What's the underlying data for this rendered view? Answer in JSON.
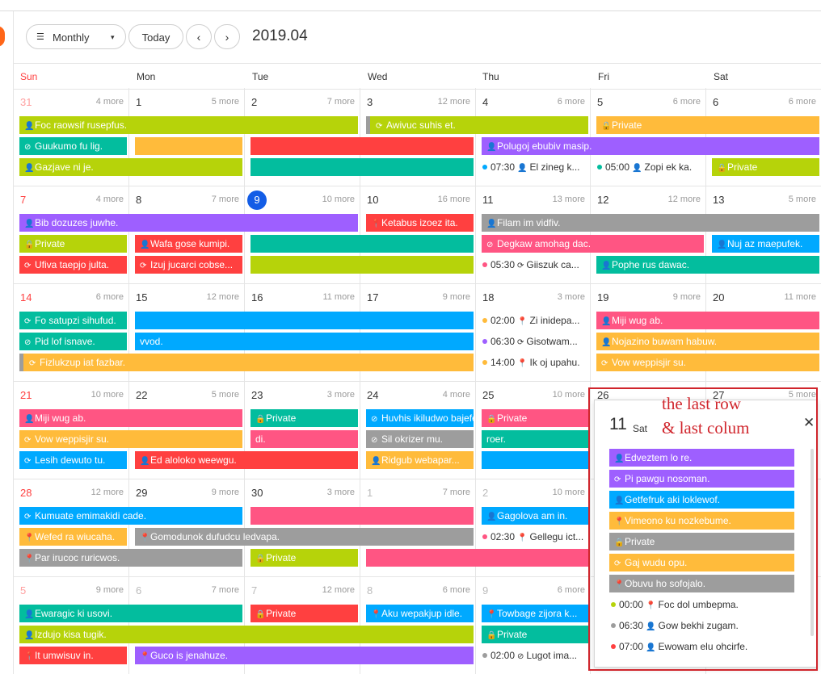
{
  "toolbar": {
    "view_label": "Monthly",
    "view_icon": "☰",
    "caret": "▾",
    "today_label": "Today",
    "prev_label": "‹",
    "next_label": "›",
    "date_range": "2019.04"
  },
  "weekdays": [
    "Sun",
    "Mon",
    "Tue",
    "Wed",
    "Thu",
    "Fri",
    "Sat"
  ],
  "weeks": [
    [
      {
        "d": "31",
        "m": "4 more",
        "s": "prevred"
      },
      {
        "d": "1",
        "m": "5 more"
      },
      {
        "d": "2",
        "m": "7 more"
      },
      {
        "d": "3",
        "m": "12 more"
      },
      {
        "d": "4",
        "m": "6 more"
      },
      {
        "d": "5",
        "m": "6 more"
      },
      {
        "d": "6",
        "m": "6 more"
      }
    ],
    [
      {
        "d": "7",
        "m": "4 more",
        "s": "red"
      },
      {
        "d": "8",
        "m": "7 more"
      },
      {
        "d": "9",
        "m": "10 more",
        "s": "today"
      },
      {
        "d": "10",
        "m": "16 more"
      },
      {
        "d": "11",
        "m": "13 more"
      },
      {
        "d": "12",
        "m": "12 more"
      },
      {
        "d": "13",
        "m": "5 more"
      }
    ],
    [
      {
        "d": "14",
        "m": "6 more",
        "s": "red"
      },
      {
        "d": "15",
        "m": "12 more"
      },
      {
        "d": "16",
        "m": "11 more"
      },
      {
        "d": "17",
        "m": "9 more"
      },
      {
        "d": "18",
        "m": "3 more"
      },
      {
        "d": "19",
        "m": "9 more"
      },
      {
        "d": "20",
        "m": "11 more"
      }
    ],
    [
      {
        "d": "21",
        "m": "10 more",
        "s": "red"
      },
      {
        "d": "22",
        "m": "5 more"
      },
      {
        "d": "23",
        "m": "3 more"
      },
      {
        "d": "24",
        "m": "4 more"
      },
      {
        "d": "25",
        "m": "10 more"
      },
      {
        "d": "26",
        "m": ""
      },
      {
        "d": "27",
        "m": "5 more"
      }
    ],
    [
      {
        "d": "28",
        "m": "12 more",
        "s": "red"
      },
      {
        "d": "29",
        "m": "9 more"
      },
      {
        "d": "30",
        "m": "3 more"
      },
      {
        "d": "1",
        "m": "7 more",
        "s": "prev"
      },
      {
        "d": "2",
        "m": "10 more",
        "s": "prev"
      },
      {
        "d": "",
        "m": ""
      },
      {
        "d": "",
        "m": ""
      }
    ],
    [
      {
        "d": "5",
        "m": "9 more",
        "s": "prevred"
      },
      {
        "d": "6",
        "m": "7 more",
        "s": "prev"
      },
      {
        "d": "7",
        "m": "12 more",
        "s": "prev"
      },
      {
        "d": "8",
        "m": "6 more",
        "s": "prev"
      },
      {
        "d": "9",
        "m": "6 more",
        "s": "prev"
      },
      {
        "d": "",
        "m": ""
      },
      {
        "d": "",
        "m": ""
      }
    ]
  ],
  "colors": {
    "lime": "#b6d30a",
    "green": "#03bd9e",
    "blue": "#00a9ff",
    "purple": "#9e5fff",
    "orange": "#ffbb3b",
    "red": "#ff4040",
    "pink": "#ff5583",
    "gray": "#9d9d9d"
  },
  "events": [
    {
      "w": 0,
      "c": 0,
      "span": 3,
      "r": 0,
      "title": "Foc raowsif rusepfus.",
      "icon": "👤",
      "color": "lime"
    },
    {
      "w": 0,
      "c": 3,
      "span": 2,
      "r": 0,
      "title": "Awivuc suhis et.",
      "icon": "⟳",
      "color": "lime",
      "lead": "gray"
    },
    {
      "w": 0,
      "c": 5,
      "span": 2,
      "r": 0,
      "title": "Private",
      "icon": "🔒",
      "color": "orange"
    },
    {
      "w": 0,
      "c": 0,
      "span": 1,
      "r": 1,
      "title": "Guukumo fu lig.",
      "icon": "⊘",
      "color": "green"
    },
    {
      "w": 0,
      "c": 1,
      "span": 1,
      "r": 1,
      "title": "",
      "icon": "",
      "color": "orange"
    },
    {
      "w": 0,
      "c": 2,
      "span": 2,
      "r": 1,
      "title": "",
      "icon": "",
      "color": "red"
    },
    {
      "w": 0,
      "c": 4,
      "span": 3,
      "r": 1,
      "title": "Polugoj ebubiv masip.",
      "icon": "👤",
      "color": "purple"
    },
    {
      "w": 0,
      "c": 0,
      "span": 2,
      "r": 2,
      "title": "Gazjave ni je.",
      "icon": "👤",
      "color": "lime"
    },
    {
      "w": 0,
      "c": 2,
      "span": 2,
      "r": 2,
      "title": "",
      "icon": "",
      "color": "green"
    },
    {
      "w": 0,
      "c": 6,
      "span": 1,
      "r": 2,
      "title": "Private",
      "icon": "🔒",
      "color": "lime"
    },
    {
      "w": 1,
      "c": 0,
      "span": 3,
      "r": 0,
      "title": "Bib dozuzes juwhe.",
      "icon": "👤",
      "color": "purple"
    },
    {
      "w": 1,
      "c": 3,
      "span": 1,
      "r": 0,
      "title": "Ketabus izoez ita.",
      "icon": "📍",
      "color": "red"
    },
    {
      "w": 1,
      "c": 4,
      "span": 3,
      "r": 0,
      "title": "Filam im vidfiv.",
      "icon": "👤",
      "color": "gray"
    },
    {
      "w": 1,
      "c": 0,
      "span": 1,
      "r": 1,
      "title": "Private",
      "icon": "🔒",
      "color": "lime"
    },
    {
      "w": 1,
      "c": 1,
      "span": 1,
      "r": 1,
      "title": "Wafa gose kumipi.",
      "icon": "👤",
      "color": "red"
    },
    {
      "w": 1,
      "c": 2,
      "span": 2,
      "r": 1,
      "title": "",
      "icon": "",
      "color": "green"
    },
    {
      "w": 1,
      "c": 4,
      "span": 2,
      "r": 1,
      "title": "Degkaw amohag dac.",
      "icon": "⊘",
      "color": "pink"
    },
    {
      "w": 1,
      "c": 6,
      "span": 1,
      "r": 1,
      "title": "Nuj az maepufek.",
      "icon": "👤",
      "color": "blue"
    },
    {
      "w": 1,
      "c": 0,
      "span": 1,
      "r": 2,
      "title": "Ufiva taepjo julta.",
      "icon": "⟳",
      "color": "red"
    },
    {
      "w": 1,
      "c": 1,
      "span": 1,
      "r": 2,
      "title": "Izuj jucarci cobse...",
      "icon": "⟳",
      "color": "red"
    },
    {
      "w": 1,
      "c": 2,
      "span": 2,
      "r": 2,
      "title": "",
      "icon": "",
      "color": "lime"
    },
    {
      "w": 1,
      "c": 5,
      "span": 2,
      "r": 2,
      "title": "Pophe rus dawac.",
      "icon": "👤",
      "color": "green"
    },
    {
      "w": 2,
      "c": 0,
      "span": 1,
      "r": 0,
      "title": "Fo satupzi sihufud.",
      "icon": "⟳",
      "color": "green"
    },
    {
      "w": 2,
      "c": 1,
      "span": 3,
      "r": 0,
      "title": "",
      "icon": "",
      "color": "blue"
    },
    {
      "w": 2,
      "c": 5,
      "span": 2,
      "r": 0,
      "title": "Miji wug ab.",
      "icon": "👤",
      "color": "pink"
    },
    {
      "w": 2,
      "c": 0,
      "span": 1,
      "r": 1,
      "title": "Pid lof isnave.",
      "icon": "⊘",
      "color": "green"
    },
    {
      "w": 2,
      "c": 1,
      "span": 3,
      "r": 1,
      "title": "vvod.",
      "icon": "",
      "color": "blue"
    },
    {
      "w": 2,
      "c": 5,
      "span": 2,
      "r": 1,
      "title": "Nojazino buwam habuw.",
      "icon": "👤",
      "color": "orange"
    },
    {
      "w": 2,
      "c": 0,
      "span": 4,
      "r": 2,
      "title": "Fizlukzup iat fazbar.",
      "icon": "⟳",
      "color": "orange",
      "lead": "gray"
    },
    {
      "w": 2,
      "c": 5,
      "span": 2,
      "r": 2,
      "title": "Vow weppisjir su.",
      "icon": "⟳",
      "color": "orange"
    },
    {
      "w": 3,
      "c": 0,
      "span": 2,
      "r": 0,
      "title": "Miji wug ab.",
      "icon": "👤",
      "color": "pink"
    },
    {
      "w": 3,
      "c": 2,
      "span": 1,
      "r": 0,
      "title": "Private",
      "icon": "🔒",
      "color": "green"
    },
    {
      "w": 3,
      "c": 3,
      "span": 1,
      "r": 0,
      "title": "Huvhis ikiludwo bajefe",
      "icon": "⊘",
      "color": "blue"
    },
    {
      "w": 3,
      "c": 4,
      "span": 1,
      "r": 0,
      "title": "Private",
      "icon": "🔒",
      "color": "pink"
    },
    {
      "w": 3,
      "c": 0,
      "span": 2,
      "r": 1,
      "title": "Vow weppisjir su.",
      "icon": "⟳",
      "color": "orange"
    },
    {
      "w": 3,
      "c": 2,
      "span": 1,
      "r": 1,
      "title": "di.",
      "icon": "",
      "color": "pink"
    },
    {
      "w": 3,
      "c": 3,
      "span": 1,
      "r": 1,
      "title": "Sil okrizer mu.",
      "icon": "⊘",
      "color": "gray"
    },
    {
      "w": 3,
      "c": 4,
      "span": 1,
      "r": 1,
      "title": "roer.",
      "icon": "",
      "color": "green"
    },
    {
      "w": 3,
      "c": 0,
      "span": 1,
      "r": 2,
      "title": "Lesih dewuto tu.",
      "icon": "⟳",
      "color": "blue"
    },
    {
      "w": 3,
      "c": 1,
      "span": 2,
      "r": 2,
      "title": "Ed aloloko weewgu.",
      "icon": "👤",
      "color": "red"
    },
    {
      "w": 3,
      "c": 3,
      "span": 1,
      "r": 2,
      "title": "Ridgub webapar...",
      "icon": "👤",
      "color": "orange"
    },
    {
      "w": 3,
      "c": 4,
      "span": 1,
      "r": 2,
      "title": "",
      "icon": "",
      "color": "blue"
    },
    {
      "w": 4,
      "c": 0,
      "span": 2,
      "r": 0,
      "title": "Kumuate emimakidi cade.",
      "icon": "⟳",
      "color": "blue"
    },
    {
      "w": 4,
      "c": 2,
      "span": 2,
      "r": 0,
      "title": "",
      "icon": "",
      "color": "pink"
    },
    {
      "w": 4,
      "c": 4,
      "span": 1,
      "r": 0,
      "title": "Gagolova am in.",
      "icon": "👤",
      "color": "blue"
    },
    {
      "w": 4,
      "c": 0,
      "span": 1,
      "r": 1,
      "title": "Wefed ra wiucaha.",
      "icon": "📍",
      "color": "orange"
    },
    {
      "w": 4,
      "c": 1,
      "span": 3,
      "r": 1,
      "title": "Gomodunok dufudcu ledvapa.",
      "icon": "📍",
      "color": "gray"
    },
    {
      "w": 4,
      "c": 0,
      "span": 2,
      "r": 2,
      "title": "Par irucoc ruricwos.",
      "icon": "📍",
      "color": "gray"
    },
    {
      "w": 4,
      "c": 2,
      "span": 1,
      "r": 2,
      "title": "Private",
      "icon": "🔒",
      "color": "lime"
    },
    {
      "w": 4,
      "c": 3,
      "span": 2,
      "r": 2,
      "title": "",
      "icon": "",
      "color": "pink"
    },
    {
      "w": 5,
      "c": 0,
      "span": 2,
      "r": 0,
      "title": "Ewaragic ki usovi.",
      "icon": "👤",
      "color": "green"
    },
    {
      "w": 5,
      "c": 2,
      "span": 1,
      "r": 0,
      "title": "Private",
      "icon": "🔒",
      "color": "red"
    },
    {
      "w": 5,
      "c": 3,
      "span": 1,
      "r": 0,
      "title": "Aku wepakjup idle.",
      "icon": "📍",
      "color": "blue"
    },
    {
      "w": 5,
      "c": 4,
      "span": 1,
      "r": 0,
      "title": "Towbage zijora k...",
      "icon": "📍",
      "color": "blue"
    },
    {
      "w": 5,
      "c": 0,
      "span": 4,
      "r": 1,
      "title": "Izdujo kisa tugik.",
      "icon": "👤",
      "color": "lime"
    },
    {
      "w": 5,
      "c": 4,
      "span": 1,
      "r": 1,
      "title": "Private",
      "icon": "🔒",
      "color": "green"
    },
    {
      "w": 5,
      "c": 0,
      "span": 1,
      "r": 2,
      "title": "It umwisuv in.",
      "icon": "📍",
      "color": "red"
    },
    {
      "w": 5,
      "c": 1,
      "span": 3,
      "r": 2,
      "title": "Guco is jenahuze.",
      "icon": "📍",
      "color": "purple"
    }
  ],
  "timed": [
    {
      "w": 0,
      "c": 4,
      "r": 2,
      "time": "07:30",
      "icon": "👤",
      "title": "El zineg k...",
      "dot": "blue"
    },
    {
      "w": 0,
      "c": 5,
      "r": 2,
      "time": "05:00",
      "icon": "👤",
      "title": "Zopi ek ka.",
      "dot": "green"
    },
    {
      "w": 1,
      "c": 4,
      "r": 2,
      "time": "05:30",
      "icon": "⟳",
      "title": "Giiszuk ca...",
      "dot": "pink"
    },
    {
      "w": 2,
      "c": 4,
      "r": 0,
      "time": "02:00",
      "icon": "📍",
      "title": "Zi inidepa...",
      "dot": "orange"
    },
    {
      "w": 2,
      "c": 4,
      "r": 1,
      "time": "06:30",
      "icon": "⟳",
      "title": "Gisotwam...",
      "dot": "purple"
    },
    {
      "w": 2,
      "c": 4,
      "r": 2,
      "time": "14:00",
      "icon": "📍",
      "title": "Ik oj upahu.",
      "dot": "orange"
    },
    {
      "w": 4,
      "c": 4,
      "r": 1,
      "time": "02:30",
      "icon": "📍",
      "title": "Gellegu ict...",
      "dot": "pink"
    },
    {
      "w": 5,
      "c": 4,
      "r": 2,
      "time": "02:00",
      "icon": "⊘",
      "title": "Lugot ima...",
      "dot": "gray"
    }
  ],
  "popup": {
    "day": "11",
    "weekday": "Sat",
    "close": "✕",
    "items": [
      {
        "title": "Edveztem lo re.",
        "icon": "👤",
        "color": "purple"
      },
      {
        "title": "Pi pawgu nosoman.",
        "icon": "⟳",
        "color": "purple"
      },
      {
        "title": "Getfefruk aki loklewof.",
        "icon": "👤",
        "color": "blue"
      },
      {
        "title": "Vimeono ku nozkebume.",
        "icon": "📍",
        "color": "orange"
      },
      {
        "title": "Private",
        "icon": "🔒",
        "color": "gray"
      },
      {
        "title": "Gaj wudu opu.",
        "icon": "⟳",
        "color": "orange"
      },
      {
        "title": "Obuvu ho sofojalo.",
        "icon": "📍",
        "color": "gray"
      }
    ],
    "timed": [
      {
        "time": "00:00",
        "icon": "📍",
        "title": "Foc dol umbepma.",
        "dot": "lime"
      },
      {
        "time": "06:30",
        "icon": "👤",
        "title": "Gow bekhi zugam.",
        "dot": "gray"
      },
      {
        "time": "07:00",
        "icon": "👤",
        "title": "Ewowam elu ohcirfe.",
        "dot": "red"
      }
    ]
  },
  "annotation": {
    "line1": "the last row",
    "line2": "& last colum"
  }
}
